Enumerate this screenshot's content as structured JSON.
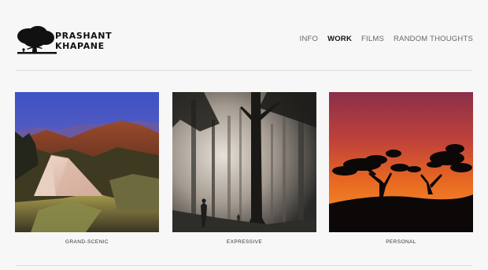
{
  "brand": {
    "line1": "PRASHANT",
    "line2": "KHAPANE"
  },
  "nav": [
    {
      "label": "INFO",
      "active": false
    },
    {
      "label": "WORK",
      "active": true
    },
    {
      "label": "FILMS",
      "active": false
    },
    {
      "label": "RANDOM THOUGHTS",
      "active": false
    }
  ],
  "gallery": [
    {
      "caption": "GRAND-SCENIC"
    },
    {
      "caption": "EXPRESSIVE"
    },
    {
      "caption": "PERSONAL"
    }
  ],
  "colors": {
    "background": "#f7f7f7",
    "rule": "#dcdcdc",
    "nav_active": "#111111",
    "nav_inactive": "#666666"
  }
}
